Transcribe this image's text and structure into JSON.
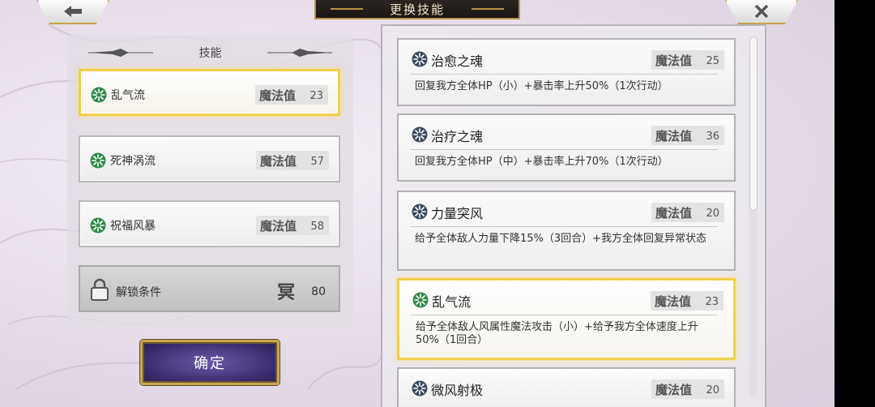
{
  "header": {
    "title": "更换技能",
    "back_icon": "arrow-left-icon",
    "close_icon": "close-x-icon"
  },
  "left_panel": {
    "title": "技能",
    "mp_label": "魔法值",
    "slots": [
      {
        "name": "乱气流",
        "mp": "23",
        "selected": true
      },
      {
        "name": "死神涡流",
        "mp": "57",
        "selected": false
      },
      {
        "name": "祝福风暴",
        "mp": "58",
        "selected": false
      }
    ],
    "locked": {
      "label": "解锁条件",
      "glyph": "冥",
      "value": "80"
    },
    "confirm_label": "确定"
  },
  "skill_list": {
    "mp_label": "魔法值",
    "items": [
      {
        "name": "治愈之魂",
        "mp": "25",
        "desc": "回复我方全体HP（小）+暴击率上升50%（1次行动）",
        "selected": false
      },
      {
        "name": "治疗之魂",
        "mp": "36",
        "desc": "回复我方全体HP（中）+暴击率上升70%（1次行动）",
        "selected": false
      },
      {
        "name": "力量突风",
        "mp": "20",
        "desc": "给予全体敌人力量下降15%（3回合）+我方全体回复异常状态",
        "selected": false
      },
      {
        "name": "乱气流",
        "mp": "23",
        "desc": "给予全体敌人风属性魔法攻击（小）+给予我方全体速度上升50%（1回合）",
        "selected": true
      },
      {
        "name": "微风射极",
        "mp": "20",
        "desc": "",
        "selected": false
      }
    ]
  },
  "colors": {
    "gold_border": "#f0d24a",
    "confirm_bg": "#3a2c6e",
    "title_bg": "#1a1714"
  }
}
